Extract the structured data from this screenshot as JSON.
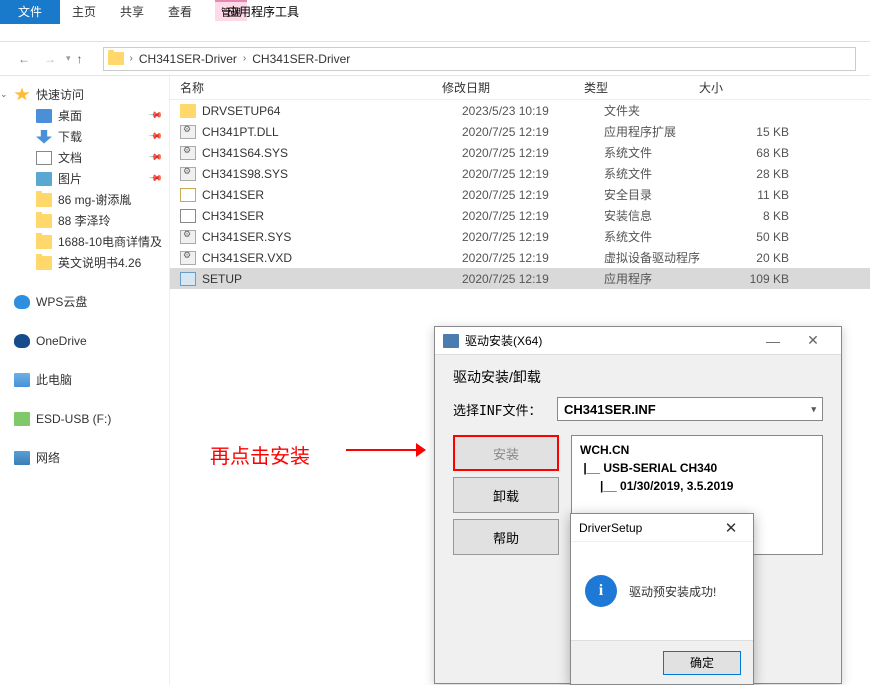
{
  "ribbon": {
    "file": "文件",
    "home": "主页",
    "share": "共享",
    "view": "查看",
    "context_group": "管理",
    "context_tab": "应用程序工具"
  },
  "breadcrumb": {
    "seg1": "CH341SER-Driver",
    "seg2": "CH341SER-Driver"
  },
  "sidebar": {
    "quick_access": "快速访问",
    "desktop": "桌面",
    "downloads": "下载",
    "documents": "文档",
    "pictures": "图片",
    "folder1": "86 mg-谢添胤",
    "folder2": "88 李泽玲",
    "folder3": "1688-10电商详情及",
    "folder4": "英文说明书4.26",
    "wps": "WPS云盘",
    "onedrive": "OneDrive",
    "thispc": "此电脑",
    "usb": "ESD-USB (F:)",
    "network": "网络"
  },
  "columns": {
    "name": "名称",
    "date": "修改日期",
    "type": "类型",
    "size": "大小"
  },
  "files": [
    {
      "icon": "folder",
      "name": "DRVSETUP64",
      "date": "2023/5/23 10:19",
      "type": "文件夹",
      "size": ""
    },
    {
      "icon": "sys",
      "name": "CH341PT.DLL",
      "date": "2020/7/25 12:19",
      "type": "应用程序扩展",
      "size": "15 KB"
    },
    {
      "icon": "sys",
      "name": "CH341S64.SYS",
      "date": "2020/7/25 12:19",
      "type": "系统文件",
      "size": "68 KB"
    },
    {
      "icon": "sys",
      "name": "CH341S98.SYS",
      "date": "2020/7/25 12:19",
      "type": "系统文件",
      "size": "28 KB"
    },
    {
      "icon": "cert",
      "name": "CH341SER",
      "date": "2020/7/25 12:19",
      "type": "安全目录",
      "size": "11 KB"
    },
    {
      "icon": "inf",
      "name": "CH341SER",
      "date": "2020/7/25 12:19",
      "type": "安装信息",
      "size": "8 KB"
    },
    {
      "icon": "sys",
      "name": "CH341SER.SYS",
      "date": "2020/7/25 12:19",
      "type": "系统文件",
      "size": "50 KB"
    },
    {
      "icon": "sys",
      "name": "CH341SER.VXD",
      "date": "2020/7/25 12:19",
      "type": "虚拟设备驱动程序",
      "size": "20 KB"
    },
    {
      "icon": "exe",
      "name": "SETUP",
      "date": "2020/7/25 12:19",
      "type": "应用程序",
      "size": "109 KB",
      "selected": true
    }
  ],
  "annotation": "再点击安装",
  "dialog1": {
    "title": "驱动安装(X64)",
    "heading": "驱动安装/卸载",
    "label_inf": "选择INF文件：",
    "inf_value": "CH341SER.INF",
    "btn_install": "安装",
    "btn_uninstall": "卸载",
    "btn_help": "帮助",
    "info_line1": "WCH.CN",
    "info_line2": " |__ USB-SERIAL CH340",
    "info_line3": "      |__ 01/30/2019, 3.5.2019"
  },
  "dialog2": {
    "title": "DriverSetup",
    "message": "驱动预安装成功!",
    "ok": "确定"
  }
}
